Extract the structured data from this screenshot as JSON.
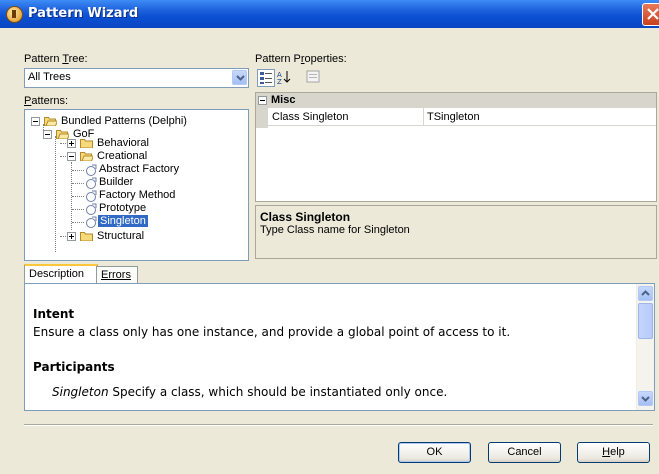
{
  "window": {
    "title": "Pattern Wizard"
  },
  "left": {
    "tree_label_pre": "Pattern ",
    "tree_label_key": "T",
    "tree_label_post": "ree:",
    "tree_select_value": "All Trees",
    "patterns_label_key": "P",
    "patterns_label_post": "atterns:"
  },
  "tree": {
    "root": "Bundled Patterns (Delphi)",
    "gof": "GoF",
    "behavioral": "Behavioral",
    "creational": "Creational",
    "items": [
      "Abstract Factory",
      "Builder",
      "Factory Method",
      "Prototype",
      "Singleton"
    ],
    "structural": "Structural"
  },
  "right": {
    "props_label_pre": "Pattern P",
    "props_label_key": "r",
    "props_label_post": "operties:",
    "category": "Misc",
    "prop_name": "Class Singleton",
    "prop_value": "TSingleton",
    "desc_title": "Class Singleton",
    "desc_text": "Type Class name for Singleton"
  },
  "tabs": [
    "Description",
    "Errors"
  ],
  "description": {
    "intent_heading": "Intent",
    "intent_text": "Ensure a class only has one instance, and provide a global point of access to it.",
    "participants_heading": "Participants",
    "participant_name": "Singleton",
    "participant_text": " Specify a class, which should be instantiated only once."
  },
  "buttons": {
    "ok": "OK",
    "cancel": "Cancel",
    "help_key": "H",
    "help_rest": "elp"
  },
  "colors": {
    "titlebar": "#0b4fd3",
    "selection": "#316ac5",
    "dialog_bg": "#ece9d8"
  }
}
